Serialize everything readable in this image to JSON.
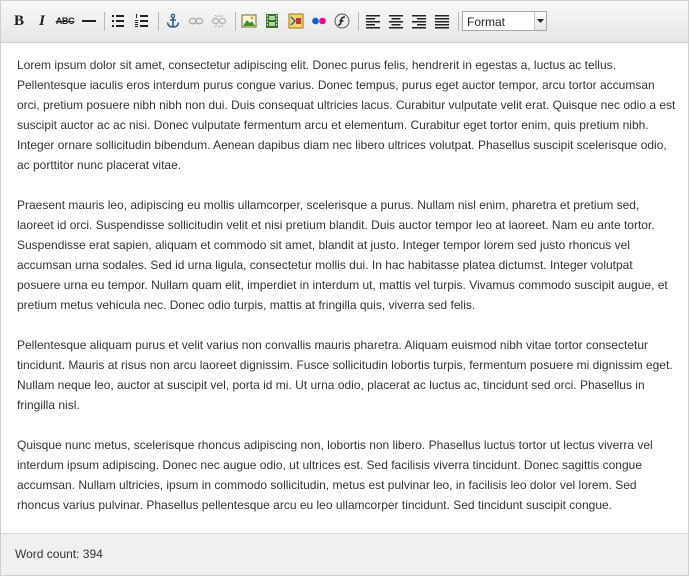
{
  "toolbar": {
    "format_select": {
      "value": "Format"
    },
    "buttons": [
      {
        "name": "bold",
        "glyph": "B"
      },
      {
        "name": "italic",
        "glyph": "I"
      },
      {
        "name": "strikethrough",
        "glyph": "ABC"
      }
    ]
  },
  "content": {
    "paragraphs": [
      "Lorem ipsum dolor sit amet, consectetur adipiscing elit. Donec purus felis, hendrerit in egestas a, luctus ac tellus. Pellentesque iaculis eros interdum purus congue varius. Donec tempus, purus eget auctor tempor, arcu tortor accumsan orci, pretium posuere nibh nibh non dui. Duis consequat ultricies lacus. Curabitur vulputate velit erat. Quisque nec odio a est suscipit auctor ac ac nisi. Donec vulputate fermentum arcu et elementum. Curabitur eget tortor enim, quis pretium nibh. Integer ornare sollicitudin bibendum. Aenean dapibus diam nec libero ultrices volutpat. Phasellus suscipit scelerisque odio, ac porttitor nunc placerat vitae.",
      "Praesent mauris leo, adipiscing eu mollis ullamcorper, scelerisque a purus. Nullam nisl enim, pharetra et pretium sed, laoreet id orci. Suspendisse sollicitudin velit et nisi pretium blandit. Duis auctor tempor leo at laoreet. Nam eu ante tortor. Suspendisse erat sapien, aliquam et commodo sit amet, blandit at justo. Integer tempor lorem sed justo rhoncus vel accumsan urna sodales. Sed id urna ligula, consectetur mollis dui. In hac habitasse platea dictumst. Integer volutpat posuere urna eu tempor. Nullam quam elit, imperdiet in interdum ut, mattis vel turpis. Vivamus commodo suscipit augue, et pretium metus vehicula nec. Donec odio turpis, mattis at fringilla quis, viverra sed felis.",
      "Pellentesque aliquam purus et velit varius non convallis mauris pharetra. Aliquam euismod nibh vitae tortor consectetur tincidunt. Mauris at risus non arcu laoreet dignissim. Fusce sollicitudin lobortis turpis, fermentum posuere mi dignissim eget. Nullam neque leo, auctor at suscipit vel, porta id mi. Ut urna odio, placerat ac luctus ac, tincidunt sed orci. Phasellus in fringilla nisl.",
      "Quisque nunc metus, scelerisque rhoncus adipiscing non, lobortis non libero. Phasellus luctus tortor ut lectus viverra vel interdum ipsum adipiscing. Donec nec augue odio, ut ultrices est. Sed facilisis viverra tincidunt. Donec sagittis congue accumsan. Nullam ultricies, ipsum in commodo sollicitudin, metus est pulvinar leo, in facilisis leo dolor vel lorem. Sed rhoncus varius pulvinar. Phasellus pellentesque arcu eu leo ullamcorper tincidunt. Sed tincidunt suscipit congue."
    ]
  },
  "statusbar": {
    "word_count": "Word count: 394"
  }
}
